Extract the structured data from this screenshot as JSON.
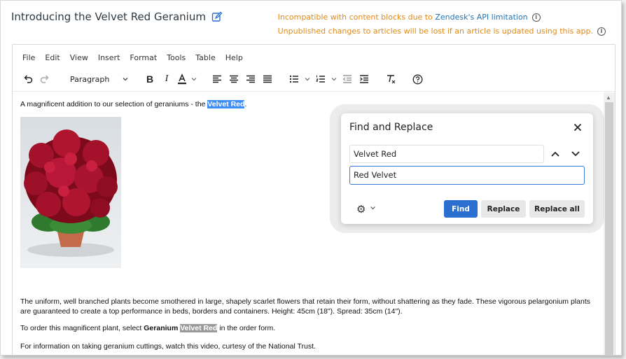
{
  "article": {
    "title": "Introducing the Velvet Red Geranium"
  },
  "notices": {
    "line1_prefix": "Incompatible with content blocks due to ",
    "line1_link": "Zendesk's API limitation",
    "line2": "Unpublished changes to articles will be lost if an article is updated using this app."
  },
  "menubar": [
    "File",
    "Edit",
    "View",
    "Insert",
    "Format",
    "Tools",
    "Table",
    "Help"
  ],
  "toolbar": {
    "block_format": "Paragraph",
    "icons": [
      "undo-icon",
      "redo-icon",
      "bold-icon",
      "italic-icon",
      "text-color-icon",
      "align-left-icon",
      "align-center-icon",
      "align-right-icon",
      "justify-icon",
      "bullet-list-icon",
      "numbered-list-icon",
      "outdent-icon",
      "indent-icon",
      "clear-formatting-icon",
      "help-icon"
    ]
  },
  "content": {
    "intro_before": "A magnificent addition to our selection of geraniums - the ",
    "intro_highlight": "Velvet Red",
    "intro_after": ".",
    "para1": "The uniform, well branched plants become smothered in large, shapely scarlet flowers that retain their form, without shattering as they fade. These vigorous pelargonium plants are guaranteed to create a top performance in beds, borders and containers. Height: 45cm (18\"). Spread: 35cm (14\").",
    "para2_before": "To order this magnificent plant, select ",
    "para2_bold": "Geranium",
    "para2_space": " ",
    "para2_highlight": "Velvet Red",
    "para2_after": " in the order form.",
    "para3": "For information on taking geranium cuttings, watch this video, curtesy of the National Trust."
  },
  "find_replace": {
    "title": "Find and Replace",
    "find_value": "Velvet Red",
    "replace_value": "Red Velvet",
    "find_button": "Find",
    "replace_button": "Replace",
    "replace_all_button": "Replace all"
  },
  "colors": {
    "notice": "#e08a18",
    "link": "#1f73b7",
    "primary_button": "#2b6fd1",
    "search_highlight": "#3f8ef5"
  }
}
